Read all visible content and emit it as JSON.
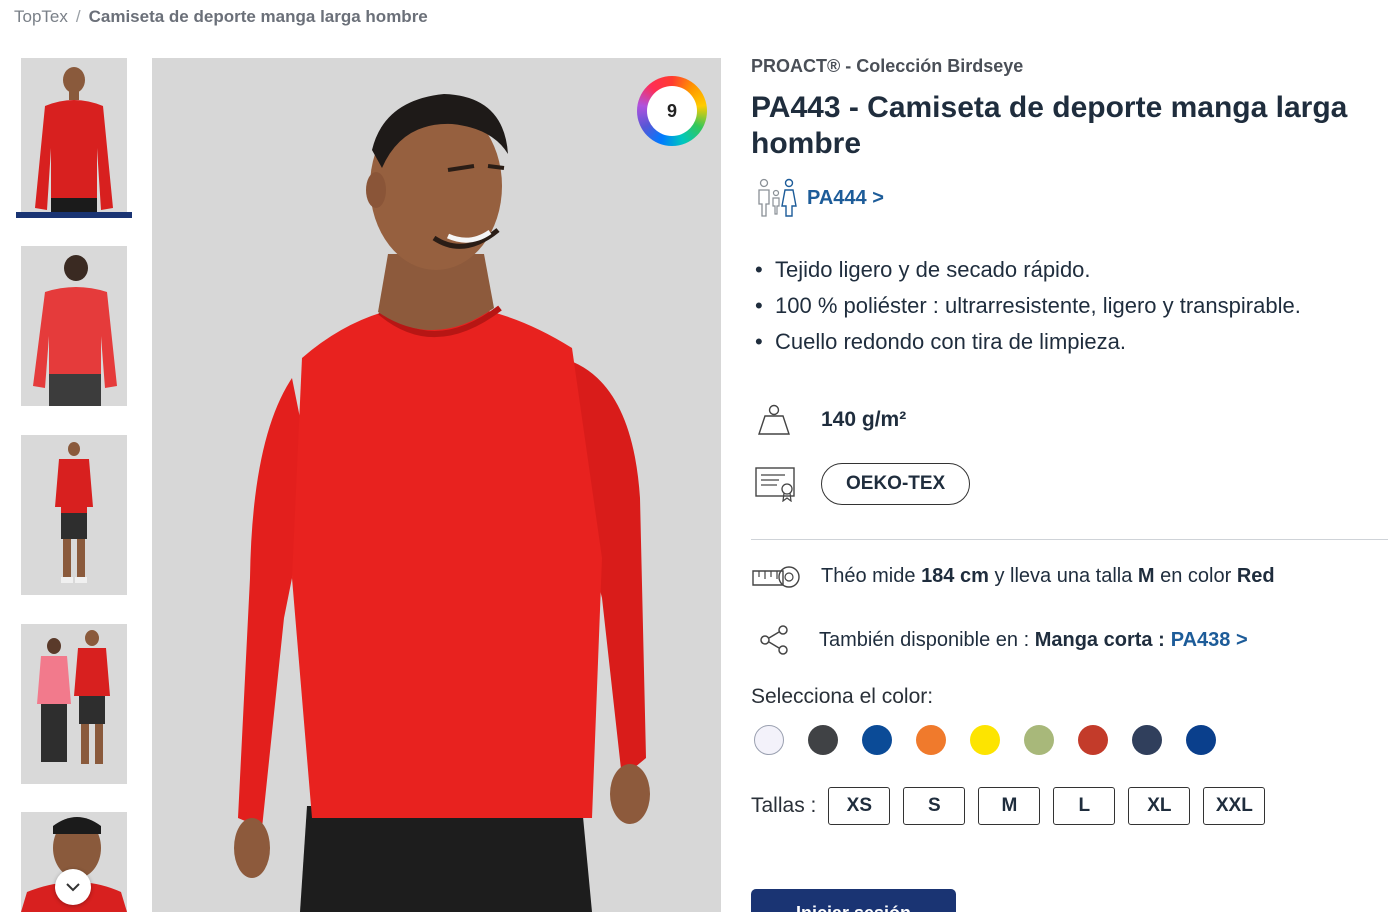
{
  "breadcrumb": {
    "home": "TopTex",
    "separator": "/",
    "current": "Camiseta de deporte manga larga hombre"
  },
  "gallery": {
    "color_count": "9",
    "thumbnails": [
      "front",
      "back",
      "full-body",
      "couple",
      "closeup"
    ]
  },
  "product": {
    "brand": "PROACT® - Colección Birdseye",
    "title": "PA443 - Camiseta de deporte manga larga hombre",
    "variant_link": "PA444 >",
    "features": [
      "Tejido ligero y de secado rápido.",
      "100 % poliéster : ultrarresistente, ligero y transpirable.",
      "Cuello redondo con tira de limpieza."
    ],
    "weight": "140 g/m²",
    "certification": "OEKO-TEX",
    "model": {
      "t1": "Théo mide ",
      "height": "184 cm",
      "t2": " y lleva una talla ",
      "size": "M",
      "t3": " en color ",
      "color": "Red"
    },
    "availability": {
      "t1": "También disponible en : ",
      "variant": "Manga corta :",
      "link": "PA438 >"
    },
    "color_label": "Selecciona el color:",
    "colors": [
      "#f3f2fa",
      "#404245",
      "#0b4b97",
      "#f07a2c",
      "#fde400",
      "#a8b87a",
      "#c33b2a",
      "#303f5c",
      "#0a3f8c"
    ],
    "sizes_label": "Tallas :",
    "sizes": [
      "XS",
      "S",
      "M",
      "L",
      "XL",
      "XXL"
    ],
    "cta": "Iniciar sesión"
  }
}
